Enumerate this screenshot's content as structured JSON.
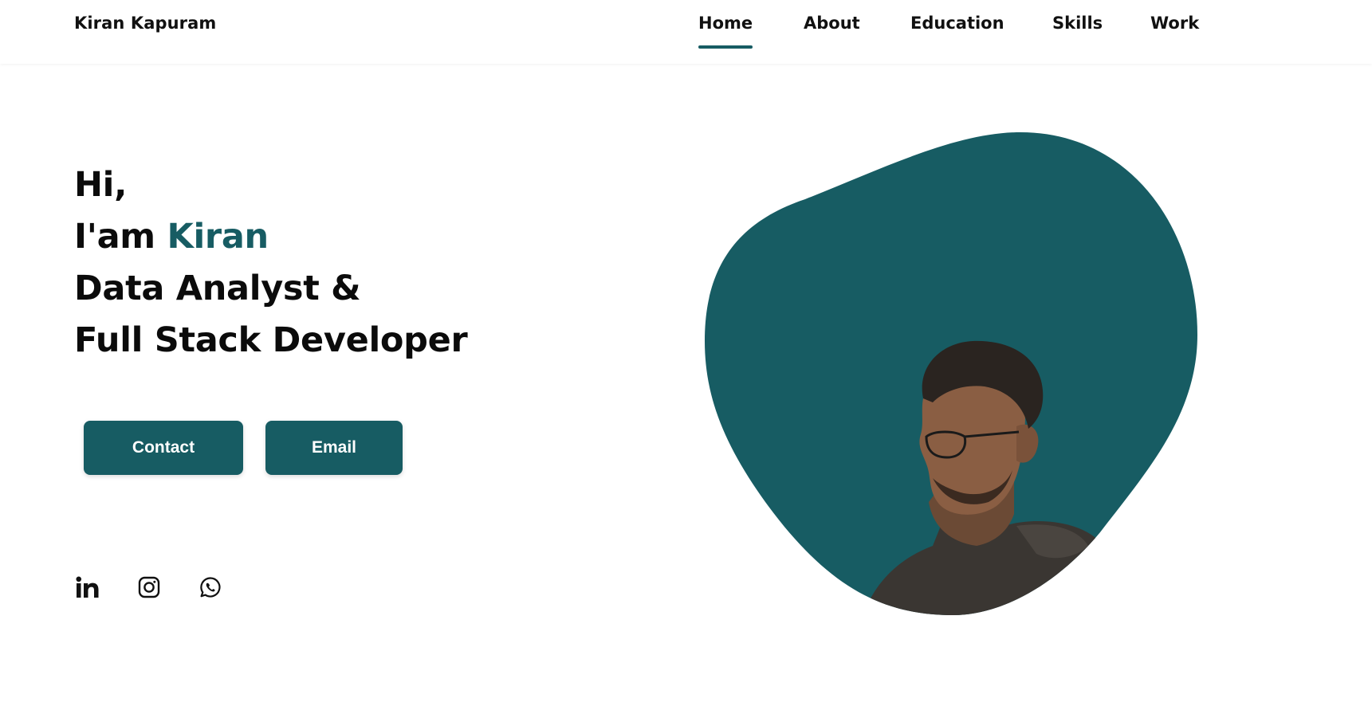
{
  "header": {
    "brand": "Kiran Kapuram",
    "nav": [
      {
        "label": "Home",
        "active": true
      },
      {
        "label": "About",
        "active": false
      },
      {
        "label": "Education",
        "active": false
      },
      {
        "label": "Skills",
        "active": false
      },
      {
        "label": "Work",
        "active": false
      }
    ]
  },
  "hero": {
    "greeting": "Hi,",
    "intro_prefix": "I'am",
    "name": "Kiran",
    "role_line1": "Data Analyst &",
    "role_line2": "Full Stack Developer",
    "contact_label": "Contact",
    "email_label": "Email"
  },
  "social": [
    {
      "icon": "linkedin-icon"
    },
    {
      "icon": "instagram-icon"
    },
    {
      "icon": "whatsapp-icon"
    }
  ],
  "colors": {
    "accent": "#175c63",
    "text": "#111111",
    "background": "#ffffff"
  }
}
